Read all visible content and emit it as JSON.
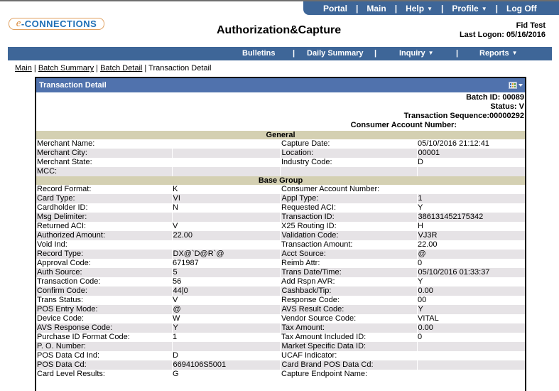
{
  "top_nav": {
    "items": [
      {
        "label": "Portal",
        "dropdown": false
      },
      {
        "label": "Main",
        "dropdown": false
      },
      {
        "label": "Help",
        "dropdown": true
      },
      {
        "label": "Profile",
        "dropdown": true
      },
      {
        "label": "Log Off",
        "dropdown": false
      }
    ]
  },
  "brand": {
    "logo_prefix": "e",
    "logo_text": "-CONNECTIONS"
  },
  "header": {
    "title": "Authorization&Capture",
    "user_name": "Fid Test",
    "last_logon": "Last Logon: 05/16/2016"
  },
  "main_nav": {
    "items": [
      {
        "label": "Bulletins",
        "dropdown": false
      },
      {
        "label": "Daily Summary",
        "dropdown": false
      },
      {
        "label": "Inquiry",
        "dropdown": true
      },
      {
        "label": "Reports",
        "dropdown": true
      }
    ]
  },
  "breadcrumb": {
    "links": [
      "Main",
      "Batch Summary",
      "Batch Detail"
    ],
    "current": "Transaction Detail",
    "separator": " | "
  },
  "panel": {
    "title": "Transaction Detail",
    "grid_icon": "grid-columns-icon",
    "summary": {
      "batch_id": "Batch ID: 00089",
      "status": "Status: V",
      "transaction_sequence": "Transaction Sequence:00000292",
      "consumer_account_number": "Consumer Account Number:"
    },
    "sections": [
      {
        "title": "General",
        "rows": [
          [
            "Merchant Name:",
            "",
            "Capture Date:",
            "05/10/2016 21:12:41"
          ],
          [
            "Merchant City:",
            "",
            "Location:",
            "00001"
          ],
          [
            "Merchant State:",
            "",
            "Industry Code:",
            "D"
          ],
          [
            "MCC:",
            "",
            "",
            ""
          ]
        ]
      },
      {
        "title": "Base Group",
        "rows": [
          [
            "Record Format:",
            "K",
            "Consumer Account Number:",
            ""
          ],
          [
            "Card Type:",
            "VI",
            "Appl Type:",
            "1"
          ],
          [
            "Cardholder ID:",
            "N",
            "Requested ACI:",
            "Y"
          ],
          [
            "Msg Delimiter:",
            "",
            "Transaction ID:",
            "386131452175342"
          ],
          [
            "Returned ACI:",
            "V",
            "X25 Routing ID:",
            "H"
          ],
          [
            "Authorized Amount:",
            "22.00",
            "Validation Code:",
            "VJ3R"
          ],
          [
            "Void Ind:",
            "",
            "Transaction Amount:",
            "22.00"
          ],
          [
            "Record Type:",
            "DX@`D@R`@",
            "Acct Source:",
            "@"
          ],
          [
            "Approval Code:",
            "671987",
            "Reimb Attr:",
            "0"
          ],
          [
            "Auth Source:",
            "5",
            "Trans Date/Time:",
            "05/10/2016 01:33:37"
          ],
          [
            "Transaction Code:",
            "56",
            "Add Rspn AVR:",
            "Y"
          ],
          [
            "Confirm Code:",
            "44|0",
            "Cashback/Tip:",
            "0.00"
          ],
          [
            "Trans Status:",
            "V",
            "Response Code:",
            "00"
          ],
          [
            "POS Entry Mode:",
            "@",
            "AVS Result Code:",
            "Y"
          ],
          [
            "Device Code:",
            "W",
            "Vendor Source Code:",
            "VITAL"
          ],
          [
            "AVS Response Code:",
            "Y",
            "Tax Amount:",
            "0.00"
          ],
          [
            "Purchase ID Format Code:",
            "1",
            "Tax Amount Included ID:",
            "0"
          ],
          [
            "P. O. Number:",
            "",
            "Market Specific Data ID:",
            ""
          ],
          [
            "POS Data Cd Ind:",
            "D",
            "UCAF Indicator:",
            ""
          ],
          [
            "POS Data Cd:",
            "6694106S5001",
            "Card Brand POS Data Cd:",
            ""
          ],
          [
            "Card Level Results:",
            "G",
            "Capture Endpoint Name:",
            ""
          ]
        ]
      }
    ]
  }
}
